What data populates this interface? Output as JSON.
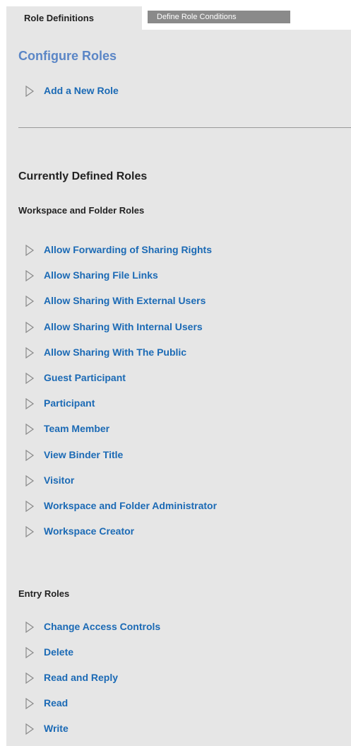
{
  "tabs": {
    "role_definitions": "Role Definitions",
    "define_role_conditions": "Define Role Conditions"
  },
  "configure": {
    "title": "Configure Roles",
    "add_new_role": "Add a New Role"
  },
  "currently_defined": {
    "heading": "Currently Defined Roles",
    "workspace_heading": "Workspace and Folder Roles",
    "workspace_roles": [
      "Allow Forwarding of Sharing Rights",
      "Allow Sharing File Links",
      "Allow Sharing With External Users",
      "Allow Sharing With Internal Users",
      "Allow Sharing With The Public",
      "Guest Participant",
      "Participant",
      "Team Member",
      "View Binder Title",
      "Visitor",
      "Workspace and Folder Administrator",
      "Workspace Creator"
    ],
    "entry_heading": "Entry Roles",
    "entry_roles": [
      "Change Access Controls",
      "Delete",
      "Read and Reply",
      "Read",
      "Write"
    ]
  },
  "icons": {
    "expand": "expand-triangle-icon"
  },
  "colors": {
    "panel_bg": "#e6e6e6",
    "link": "#1b6ab5",
    "title": "#5b86c6",
    "inactive_tab": "#8a8a8a"
  }
}
